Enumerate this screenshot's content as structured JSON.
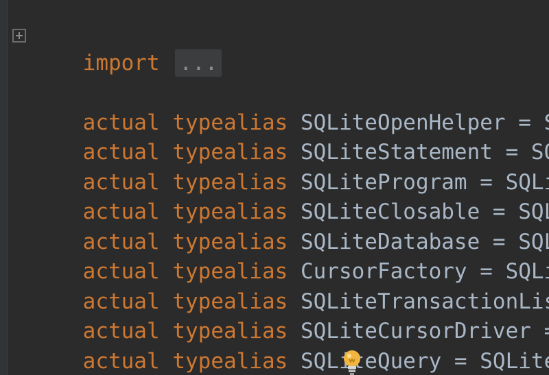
{
  "editor": {
    "import_keyword": "import",
    "import_folded": "...",
    "lines": [
      {
        "keyword1": "actual",
        "keyword2": "typealias",
        "text": "SQLiteOpenHelper = SQ"
      },
      {
        "keyword1": "actual",
        "keyword2": "typealias",
        "text": "SQLiteStatement = SQL"
      },
      {
        "keyword1": "actual",
        "keyword2": "typealias",
        "text": "SQLiteProgram = SQLit"
      },
      {
        "keyword1": "actual",
        "keyword2": "typealias",
        "text": "SQLiteClosable = SQLi"
      },
      {
        "keyword1": "actual",
        "keyword2": "typealias",
        "text": "SQLiteDatabase = SQLi"
      },
      {
        "keyword1": "actual",
        "keyword2": "typealias",
        "text": "CursorFactory = SQLit"
      },
      {
        "keyword1": "actual",
        "keyword2": "typealias",
        "text": "SQLiteTransactionList"
      },
      {
        "keyword1": "actual",
        "keyword2": "typealias",
        "text": "SQLiteCursorDriver = "
      },
      {
        "keyword1": "actual",
        "keyword2": "typealias",
        "text": "SQLiteQuery = SQLiteC"
      }
    ]
  },
  "colors": {
    "background": "#2b2b2b",
    "keyword": "#cc7832",
    "identifier": "#a9b7c6",
    "bulb": "#f2b640"
  },
  "icons": {
    "fold": "fold-expand-icon",
    "intention": "lightbulb-icon"
  }
}
